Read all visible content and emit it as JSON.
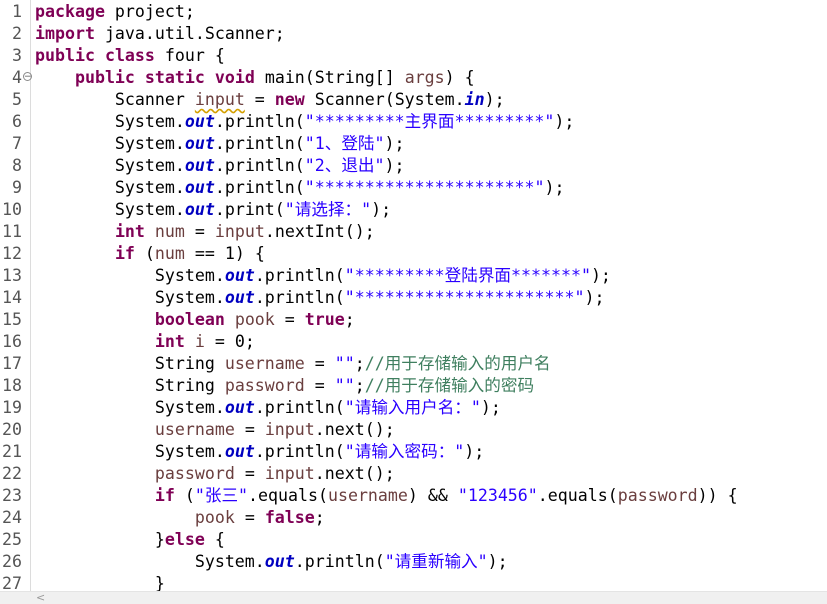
{
  "editor": {
    "lines": [
      {
        "n": "1",
        "t": [
          [
            "kw",
            "package"
          ],
          [
            "",
            " project;"
          ]
        ]
      },
      {
        "n": "2",
        "t": [
          [
            "kw",
            "import"
          ],
          [
            "",
            " java.util.Scanner;"
          ]
        ]
      },
      {
        "n": "3",
        "t": [
          [
            "kw",
            "public"
          ],
          [
            "",
            " "
          ],
          [
            "kw",
            "class"
          ],
          [
            "",
            " four {"
          ]
        ]
      },
      {
        "n": "4",
        "fold": "⊖",
        "t": [
          [
            "",
            "    "
          ],
          [
            "kw",
            "public"
          ],
          [
            "",
            " "
          ],
          [
            "kw",
            "static"
          ],
          [
            "",
            " "
          ],
          [
            "kw",
            "void"
          ],
          [
            "",
            " main(String[] "
          ],
          [
            "var",
            "args"
          ],
          [
            "",
            ") {"
          ]
        ]
      },
      {
        "n": "5",
        "t": [
          [
            "",
            "        Scanner "
          ],
          [
            "var warn",
            "input"
          ],
          [
            "",
            " = "
          ],
          [
            "kw",
            "new"
          ],
          [
            "",
            " Scanner(System."
          ],
          [
            "fld",
            "in"
          ],
          [
            "",
            ");"
          ]
        ]
      },
      {
        "n": "6",
        "t": [
          [
            "",
            "        System."
          ],
          [
            "fld",
            "out"
          ],
          [
            "",
            ".println("
          ],
          [
            "str",
            "\"*********主界面*********\""
          ],
          [
            "",
            ");"
          ]
        ]
      },
      {
        "n": "7",
        "t": [
          [
            "",
            "        System."
          ],
          [
            "fld",
            "out"
          ],
          [
            "",
            ".println("
          ],
          [
            "str",
            "\"1、登陆\""
          ],
          [
            "",
            ");"
          ]
        ]
      },
      {
        "n": "8",
        "t": [
          [
            "",
            "        System."
          ],
          [
            "fld",
            "out"
          ],
          [
            "",
            ".println("
          ],
          [
            "str",
            "\"2、退出\""
          ],
          [
            "",
            ");"
          ]
        ]
      },
      {
        "n": "9",
        "t": [
          [
            "",
            "        System."
          ],
          [
            "fld",
            "out"
          ],
          [
            "",
            ".println("
          ],
          [
            "str",
            "\"**********************\""
          ],
          [
            "",
            ");"
          ]
        ]
      },
      {
        "n": "10",
        "t": [
          [
            "",
            "        System."
          ],
          [
            "fld",
            "out"
          ],
          [
            "",
            ".print("
          ],
          [
            "str",
            "\"请选择：\""
          ],
          [
            "",
            ");"
          ]
        ]
      },
      {
        "n": "11",
        "t": [
          [
            "",
            "        "
          ],
          [
            "kw",
            "int"
          ],
          [
            "",
            " "
          ],
          [
            "var",
            "num"
          ],
          [
            "",
            " = "
          ],
          [
            "var",
            "input"
          ],
          [
            "",
            ".nextInt();"
          ]
        ]
      },
      {
        "n": "12",
        "t": [
          [
            "",
            "        "
          ],
          [
            "kw",
            "if"
          ],
          [
            "",
            " ("
          ],
          [
            "var",
            "num"
          ],
          [
            "",
            " == 1) {"
          ]
        ]
      },
      {
        "n": "13",
        "t": [
          [
            "",
            "            System."
          ],
          [
            "fld",
            "out"
          ],
          [
            "",
            ".println("
          ],
          [
            "str",
            "\"*********登陆界面*******\""
          ],
          [
            "",
            ");"
          ]
        ]
      },
      {
        "n": "14",
        "t": [
          [
            "",
            "            System."
          ],
          [
            "fld",
            "out"
          ],
          [
            "",
            ".println("
          ],
          [
            "str",
            "\"**********************\""
          ],
          [
            "",
            ");"
          ]
        ]
      },
      {
        "n": "15",
        "t": [
          [
            "",
            "            "
          ],
          [
            "kw",
            "boolean"
          ],
          [
            "",
            " "
          ],
          [
            "var",
            "pook"
          ],
          [
            "",
            " = "
          ],
          [
            "kw",
            "true"
          ],
          [
            "",
            ";"
          ]
        ]
      },
      {
        "n": "16",
        "t": [
          [
            "",
            "            "
          ],
          [
            "kw",
            "int"
          ],
          [
            "",
            " "
          ],
          [
            "var",
            "i"
          ],
          [
            "",
            " = 0;"
          ]
        ]
      },
      {
        "n": "17",
        "t": [
          [
            "",
            "            String "
          ],
          [
            "var",
            "username"
          ],
          [
            "",
            " = "
          ],
          [
            "str",
            "\"\""
          ],
          [
            "",
            ";"
          ],
          [
            "cmt",
            "//用于存储输入的用户名"
          ]
        ]
      },
      {
        "n": "18",
        "t": [
          [
            "",
            "            String "
          ],
          [
            "var",
            "password"
          ],
          [
            "",
            " = "
          ],
          [
            "str",
            "\"\""
          ],
          [
            "",
            ";"
          ],
          [
            "cmt",
            "//用于存储输入的密码"
          ]
        ]
      },
      {
        "n": "19",
        "t": [
          [
            "",
            "            System."
          ],
          [
            "fld",
            "out"
          ],
          [
            "",
            ".println("
          ],
          [
            "str",
            "\"请输入用户名：\""
          ],
          [
            "",
            ");"
          ]
        ]
      },
      {
        "n": "20",
        "t": [
          [
            "",
            "            "
          ],
          [
            "var",
            "username"
          ],
          [
            "",
            " = "
          ],
          [
            "var",
            "input"
          ],
          [
            "",
            ".next();"
          ]
        ]
      },
      {
        "n": "21",
        "t": [
          [
            "",
            "            System."
          ],
          [
            "fld",
            "out"
          ],
          [
            "",
            ".println("
          ],
          [
            "str",
            "\"请输入密码：\""
          ],
          [
            "",
            ");"
          ]
        ]
      },
      {
        "n": "22",
        "t": [
          [
            "",
            "            "
          ],
          [
            "var",
            "password"
          ],
          [
            "",
            " = "
          ],
          [
            "var",
            "input"
          ],
          [
            "",
            ".next();"
          ]
        ]
      },
      {
        "n": "23",
        "t": [
          [
            "",
            "            "
          ],
          [
            "kw",
            "if"
          ],
          [
            "",
            " ("
          ],
          [
            "str",
            "\"张三\""
          ],
          [
            "",
            ".equals("
          ],
          [
            "var",
            "username"
          ],
          [
            "",
            ") && "
          ],
          [
            "str",
            "\"123456\""
          ],
          [
            "",
            ".equals("
          ],
          [
            "var",
            "password"
          ],
          [
            "",
            ")) {"
          ]
        ]
      },
      {
        "n": "24",
        "t": [
          [
            "",
            "                "
          ],
          [
            "var",
            "pook"
          ],
          [
            "",
            " = "
          ],
          [
            "kw",
            "false"
          ],
          [
            "",
            ";"
          ]
        ]
      },
      {
        "n": "25",
        "t": [
          [
            "",
            "            }"
          ],
          [
            "kw",
            "else"
          ],
          [
            "",
            " {"
          ]
        ]
      },
      {
        "n": "26",
        "t": [
          [
            "",
            "                System."
          ],
          [
            "fld",
            "out"
          ],
          [
            "",
            ".println("
          ],
          [
            "str",
            "\"请重新输入\""
          ],
          [
            "",
            ");"
          ]
        ]
      },
      {
        "n": "27",
        "t": [
          [
            "",
            "            }"
          ]
        ]
      }
    ]
  },
  "scrollbar": {
    "left_arrow": "<"
  },
  "colors": {
    "keyword": "#7f0055",
    "string": "#2a00ff",
    "comment": "#3f7f5f",
    "field": "#0000c0",
    "variable": "#6a3e3e"
  },
  "icons": {
    "fold": "collapse-icon",
    "scroll_left": "scroll-left-icon"
  }
}
